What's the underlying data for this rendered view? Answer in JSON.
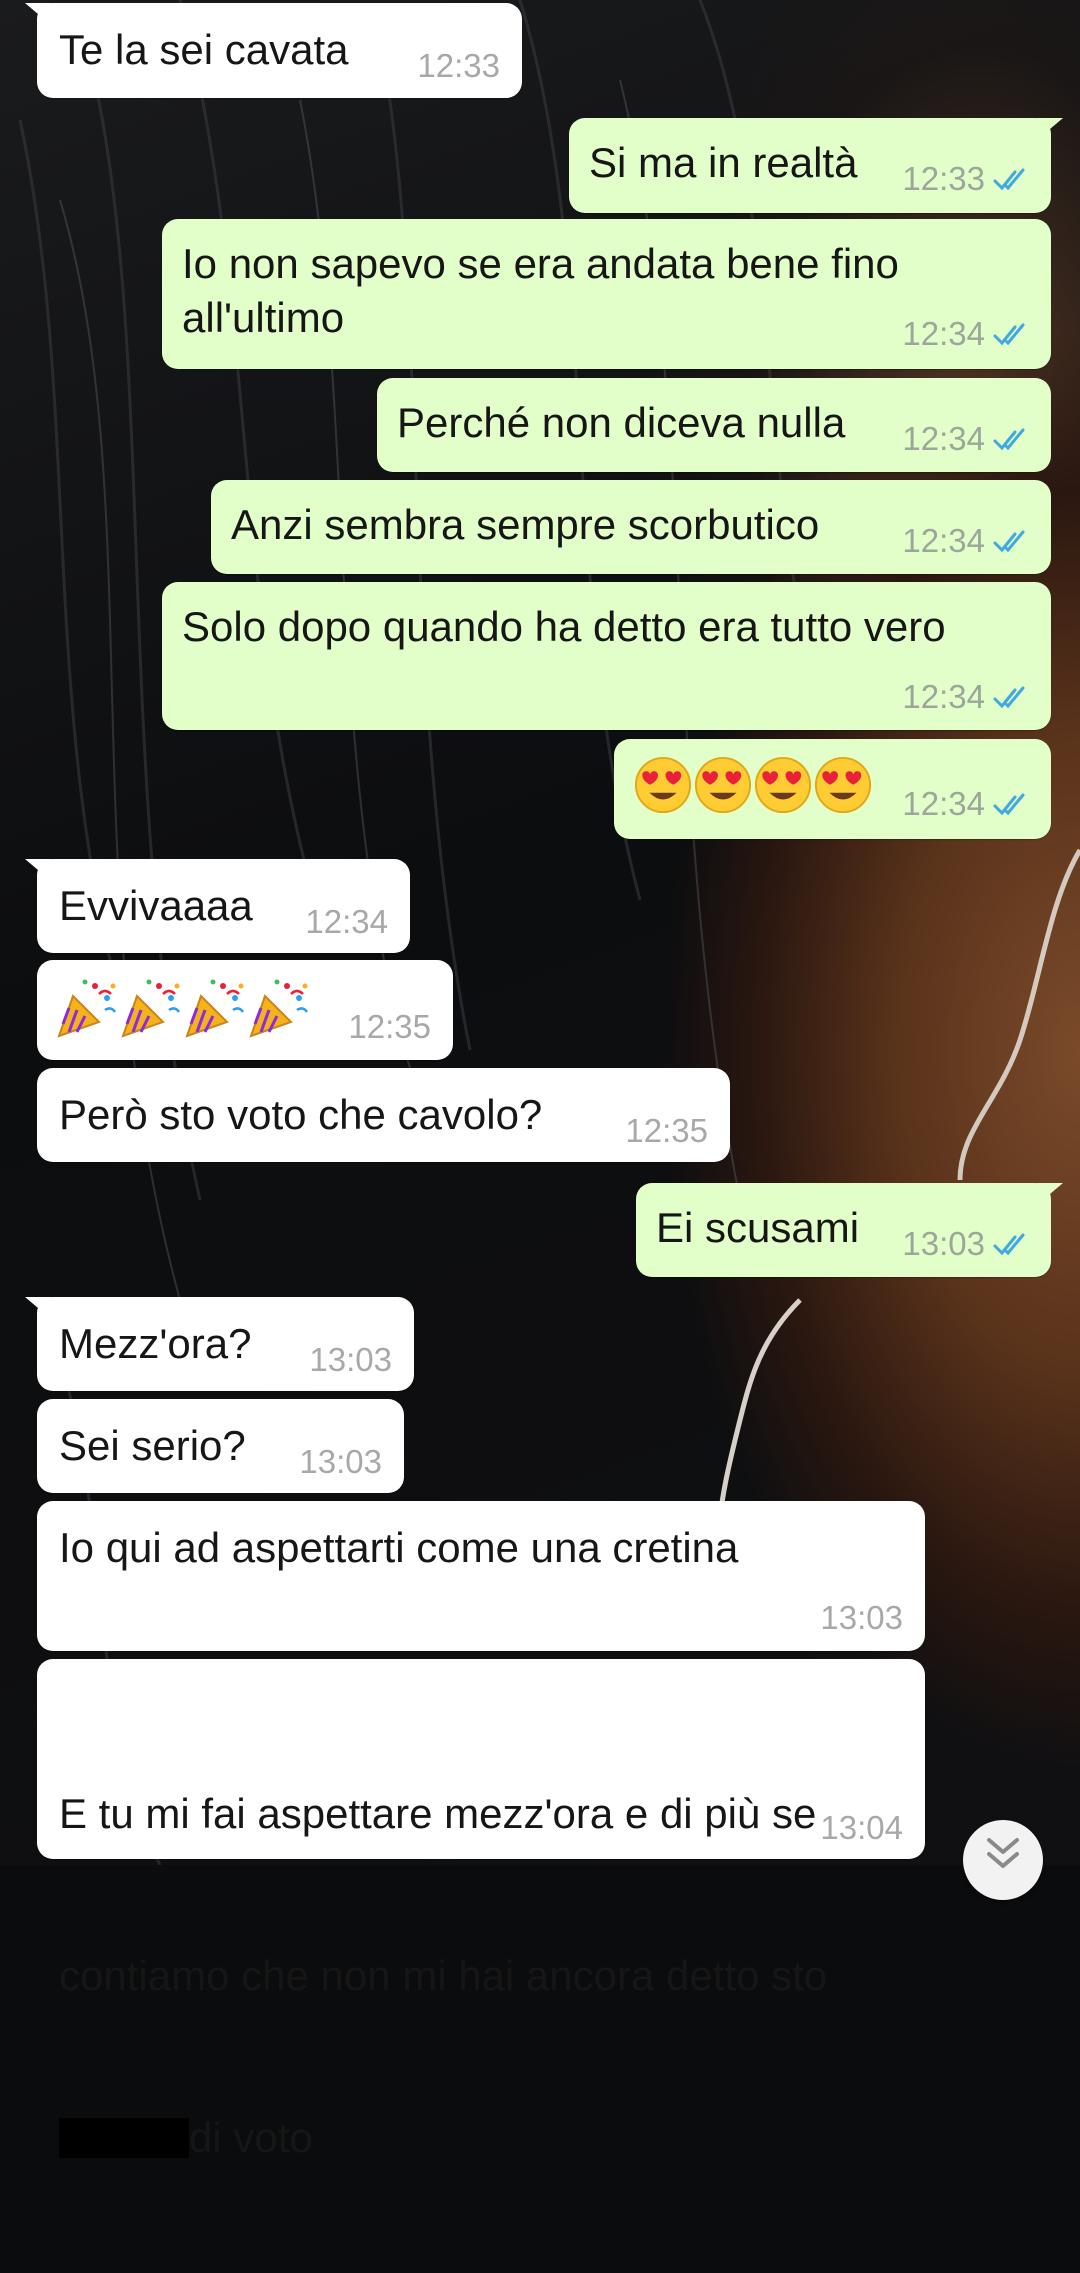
{
  "theme": {
    "incoming_bubble": "#ffffff",
    "outgoing_bubble": "#e2fec9",
    "read_ticks": "#3fa9e0",
    "timestamp_text": "#9ca69a"
  },
  "messages": [
    {
      "id": "m1",
      "direction": "incoming",
      "text": "Te la sei cavata",
      "time": "12:33"
    },
    {
      "id": "m2",
      "direction": "outgoing",
      "text": "Si ma in realtà",
      "time": "12:33",
      "status_icon": "double-check-read-icon"
    },
    {
      "id": "m3",
      "direction": "outgoing",
      "text": "Io non sapevo se era andata bene fino all'ultimo",
      "time": "12:34",
      "status_icon": "double-check-read-icon"
    },
    {
      "id": "m4",
      "direction": "outgoing",
      "text": "Perché non diceva nulla",
      "time": "12:34",
      "status_icon": "double-check-read-icon"
    },
    {
      "id": "m5",
      "direction": "outgoing",
      "text": "Anzi sembra sempre scorbutico",
      "time": "12:34",
      "status_icon": "double-check-read-icon"
    },
    {
      "id": "m6",
      "direction": "outgoing",
      "text": "Solo dopo quando ha detto era tutto vero",
      "time": "12:34",
      "status_icon": "double-check-read-icon"
    },
    {
      "id": "m7",
      "direction": "outgoing",
      "text": "😍😍😍😍",
      "time": "12:34",
      "status_icon": "double-check-read-icon",
      "emoji_icon": "heart-eyes-emoji"
    },
    {
      "id": "m8",
      "direction": "incoming",
      "text": "Evvivaaaa",
      "time": "12:34"
    },
    {
      "id": "m9",
      "direction": "incoming",
      "text": "🎉🎉🎉🎉",
      "time": "12:35",
      "emoji_icon": "party-popper-emoji"
    },
    {
      "id": "m10",
      "direction": "incoming",
      "text": "Però sto voto che cavolo?",
      "time": "12:35"
    },
    {
      "id": "m11",
      "direction": "outgoing",
      "text": "Ei scusami",
      "time": "13:03",
      "status_icon": "double-check-read-icon"
    },
    {
      "id": "m12",
      "direction": "incoming",
      "text": "Mezz'ora?",
      "time": "13:03"
    },
    {
      "id": "m13",
      "direction": "incoming",
      "text": "Sei serio?",
      "time": "13:03"
    },
    {
      "id": "m14",
      "direction": "incoming",
      "text": "Io qui ad aspettarti come una cretina",
      "time": "13:03"
    },
    {
      "id": "m15",
      "direction": "incoming",
      "text_line1": "E tu mi fai aspettare mezz'ora e di più se",
      "text_line2": "contiamo che non mi hai ancora detto sto",
      "text_line3_after_redaction": "di voto",
      "redacted": true,
      "time": "13:04"
    }
  ],
  "scroll_button": {
    "icon": "chevron-double-down-icon"
  }
}
